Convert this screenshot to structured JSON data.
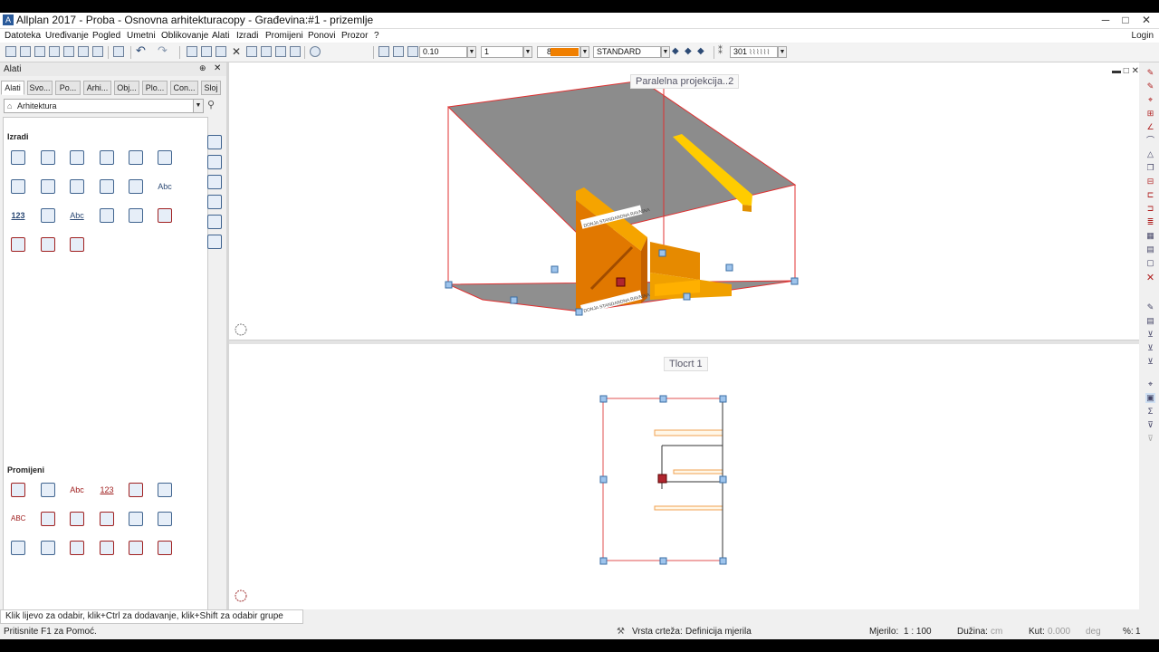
{
  "title": "Allplan 2017 - Proba - Osnovna arhitekturacopy - Građevina:#1 - prizemlje",
  "window_buttons": {
    "minimize": "─",
    "maximize": "□",
    "close": "✕"
  },
  "menu": [
    "Datoteka",
    "Uređivanje",
    "Pogled",
    "Umetni",
    "Oblikovanje",
    "Alati",
    "Izradi",
    "Promijeni",
    "Ponovi",
    "Prozor",
    "?"
  ],
  "login": "Login",
  "format_bar": {
    "pen": "0.10",
    "line": "1",
    "color_index": "8",
    "color": "#f07f00",
    "style": "STANDARD",
    "layer": "301"
  },
  "panel": {
    "title": "Alati",
    "pin": "⊕",
    "close": "✕",
    "tabs": [
      "Alati",
      "Svo...",
      "Po...",
      "Arhi...",
      "Obj...",
      "Plo...",
      "Con...",
      "Sloj"
    ],
    "selector": "Arhitektura",
    "section_create": "Izradi",
    "create_labels": [
      "123",
      "Abc",
      "Abc"
    ],
    "section_modify": "Promijeni",
    "modify_labels": [
      "Abc",
      "123",
      "ABC"
    ]
  },
  "views": {
    "top_label": "Paralelna projekcija..2",
    "bottom_label": "Tlocrt 1",
    "level_text": "DONJA STANDARDNA RAVNINA"
  },
  "prompt": "Klik lijevo za odabir, klik+Ctrl za dodavanje, klik+Shift za odabir grupe",
  "status": {
    "help": "Pritisnite F1 za Pomoć.",
    "drawing_type_label": "Vrsta crteža:",
    "drawing_type": "Definicija mjerila",
    "scale_label": "Mjerilo:",
    "scale": "1 : 100",
    "length_label": "Dužina:",
    "length_unit": "cm",
    "angle_label": "Kut:",
    "angle": "0.000",
    "angle_unit": "deg",
    "percent_label": "%:",
    "percent": "1"
  }
}
